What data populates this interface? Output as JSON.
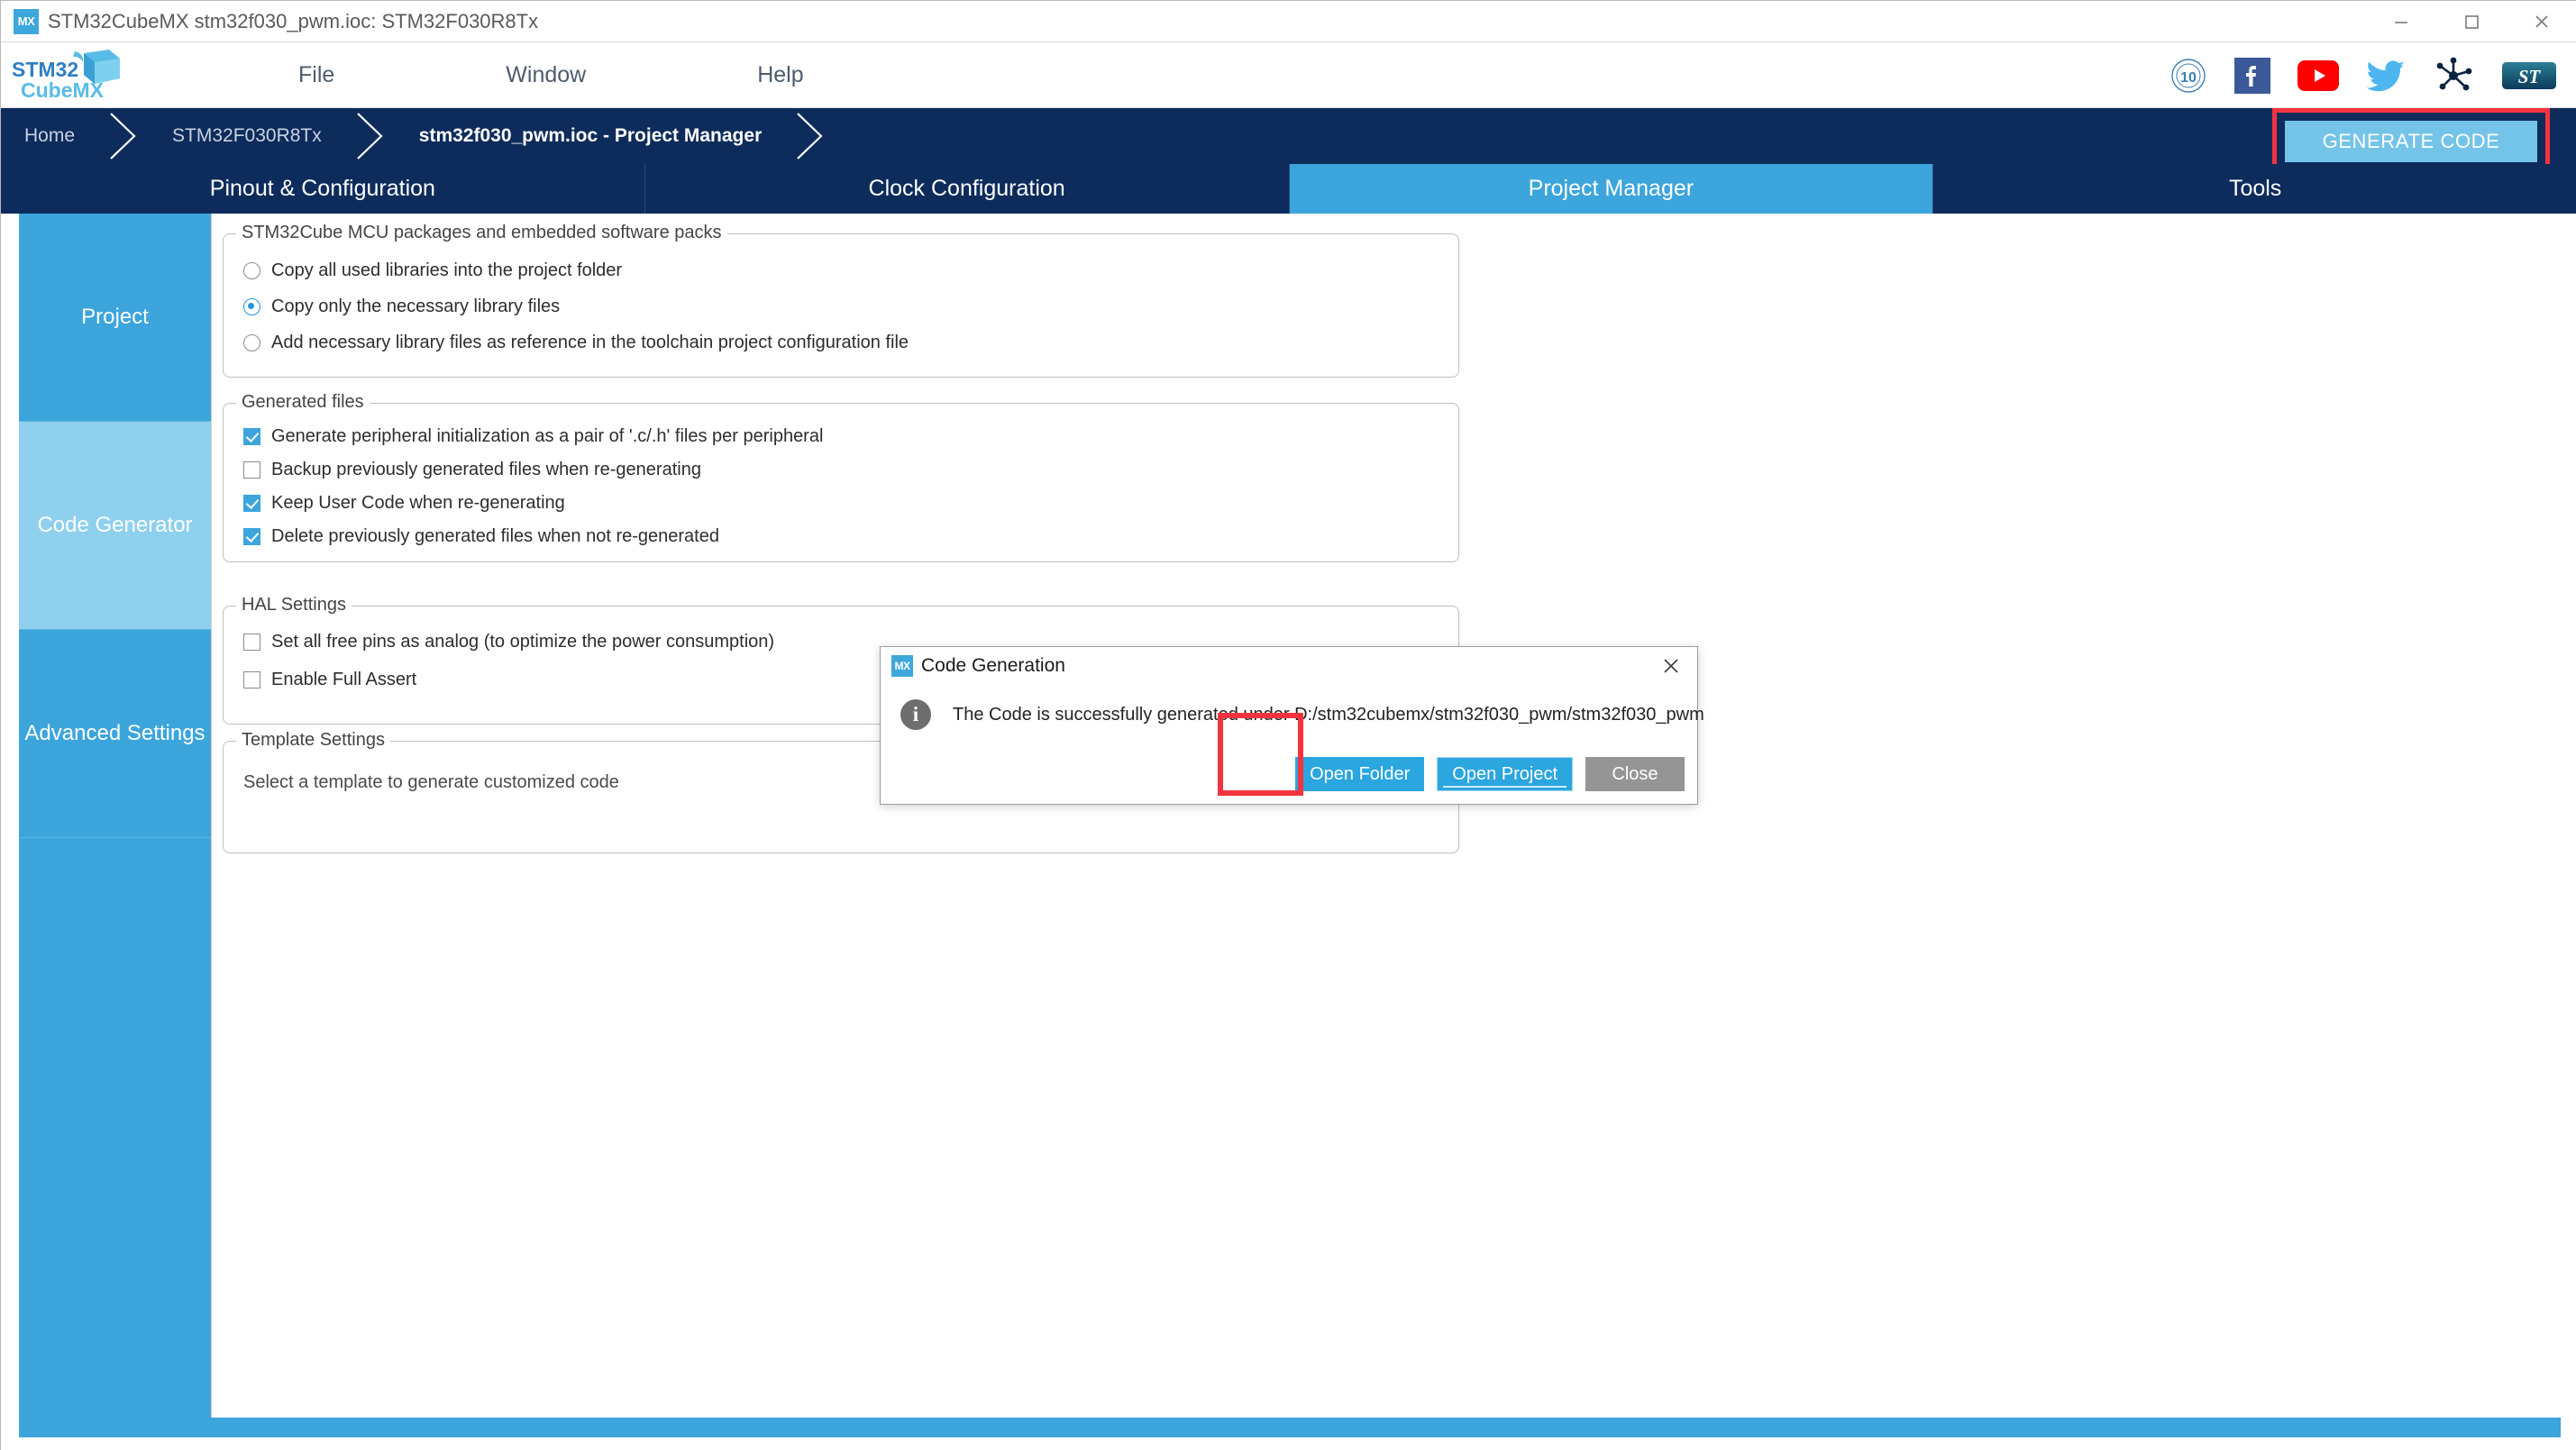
{
  "window": {
    "title": "STM32CubeMX stm32f030_pwm.ioc: STM32F030R8Tx",
    "app_icon_label": "MX",
    "minimize_label": "Minimize",
    "maximize_label": "Maximize",
    "close_label": "Close"
  },
  "menu": {
    "logo_line1": "STM32",
    "logo_line2": "CubeMX",
    "items": [
      {
        "label": "File"
      },
      {
        "label": "Window"
      },
      {
        "label": "Help"
      }
    ],
    "social": [
      {
        "name": "anniversary-10-icon",
        "label": "10"
      },
      {
        "name": "facebook-icon",
        "label": "f"
      },
      {
        "name": "youtube-icon",
        "label": "YouTube"
      },
      {
        "name": "twitter-icon",
        "label": "Twitter"
      },
      {
        "name": "st-community-icon",
        "label": "ST Community"
      },
      {
        "name": "st-logo-icon",
        "label": "ST"
      }
    ]
  },
  "breadcrumb": {
    "items": [
      {
        "label": "Home",
        "active": false
      },
      {
        "label": "STM32F030R8Tx",
        "active": false
      },
      {
        "label": "stm32f030_pwm.ioc - Project Manager",
        "active": true
      }
    ],
    "generate_code_label": "GENERATE CODE"
  },
  "tabs": [
    {
      "label": "Pinout & Configuration",
      "active": false
    },
    {
      "label": "Clock Configuration",
      "active": false
    },
    {
      "label": "Project Manager",
      "active": true
    },
    {
      "label": "Tools",
      "active": false
    }
  ],
  "sidebar": {
    "items": [
      {
        "label": "Project",
        "active": false
      },
      {
        "label": "Code Generator",
        "active": true
      },
      {
        "label": "Advanced Settings",
        "active": false
      }
    ]
  },
  "groups": {
    "packages": {
      "title": "STM32Cube MCU packages and embedded software packs",
      "options": [
        {
          "label": "Copy all used libraries into the project folder",
          "selected": false
        },
        {
          "label": "Copy only the necessary library files",
          "selected": true
        },
        {
          "label": "Add necessary library files as reference in the toolchain project configuration file",
          "selected": false
        }
      ]
    },
    "generated_files": {
      "title": "Generated files",
      "options": [
        {
          "label": "Generate peripheral initialization as a pair of '.c/.h' files per peripheral",
          "checked": true
        },
        {
          "label": "Backup previously generated files when re-generating",
          "checked": false
        },
        {
          "label": "Keep User Code when re-generating",
          "checked": true
        },
        {
          "label": "Delete previously generated files when not re-generated",
          "checked": true
        }
      ]
    },
    "hal_settings": {
      "title": "HAL Settings",
      "options": [
        {
          "label": "Set all free pins as analog (to optimize the power consumption)",
          "checked": false
        },
        {
          "label": "Enable Full Assert",
          "checked": false
        }
      ]
    },
    "template_settings": {
      "title": "Template Settings",
      "description": "Select a template to generate customized code"
    }
  },
  "dialog": {
    "icon_label": "MX",
    "title": "Code Generation",
    "close_label": "×",
    "info_glyph": "i",
    "message": "The Code is successfully generated under D:/stm32cubemx/stm32f030_pwm/stm32f030_pwm",
    "buttons": [
      {
        "label": "Open Folder",
        "style": "blue",
        "focused": false
      },
      {
        "label": "Open Project",
        "style": "blue",
        "focused": true
      },
      {
        "label": "Close",
        "style": "grey",
        "focused": false
      }
    ]
  },
  "colors": {
    "accent_blue": "#3ca5dc",
    "dark_navy": "#0d2c5c",
    "highlight_red": "#f5333f",
    "button_light_blue": "#74c3e8",
    "sidebar_active": "#8ed0ee",
    "dialog_blue": "#2ba6df",
    "dialog_grey": "#959595"
  }
}
